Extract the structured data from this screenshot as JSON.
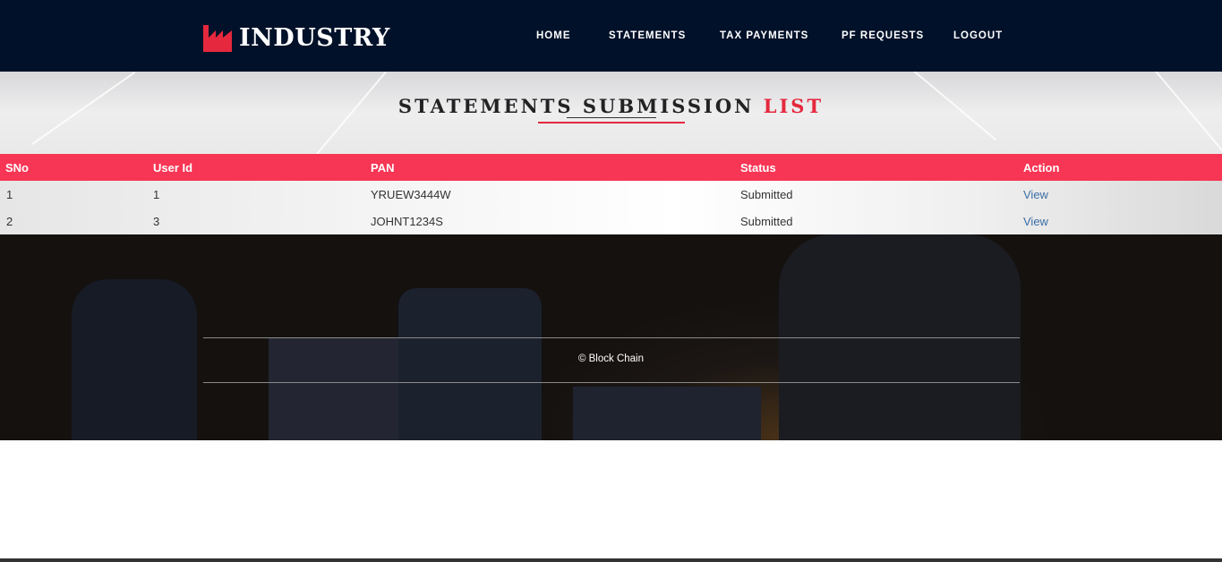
{
  "brand": {
    "name": "INDUSTRY",
    "icon": "factory-icon",
    "accent_color": "#e5283d"
  },
  "nav": {
    "items": [
      {
        "label": "HOME"
      },
      {
        "label": "STATEMENTS"
      },
      {
        "label": "TAX PAYMENTS"
      },
      {
        "label": "PF REQUESTS"
      },
      {
        "label": "LOGOUT"
      }
    ]
  },
  "page": {
    "title_part1": "STATEMENTS SUBMISSION",
    "title_part2": "LIST"
  },
  "table": {
    "header_color": "#f73554",
    "columns": [
      "SNo",
      "User Id",
      "PAN",
      "Status",
      "Action"
    ],
    "rows": [
      {
        "sno": "1",
        "user_id": "1",
        "pan": "YRUEW3444W",
        "status": "Submitted",
        "action": "View"
      },
      {
        "sno": "2",
        "user_id": "3",
        "pan": "JOHNT1234S",
        "status": "Submitted",
        "action": "View"
      }
    ]
  },
  "footer": {
    "copyright": "© Block Chain"
  }
}
